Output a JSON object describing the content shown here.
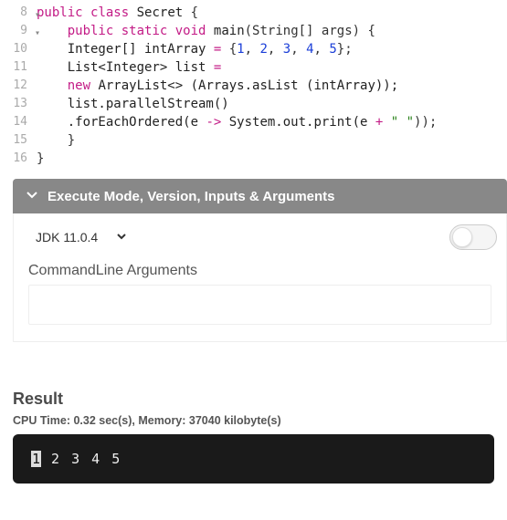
{
  "editor": {
    "lines": [
      {
        "num": "8",
        "fold": true
      },
      {
        "num": "9",
        "fold": true
      },
      {
        "num": "10"
      },
      {
        "num": "11"
      },
      {
        "num": "12"
      },
      {
        "num": "13"
      },
      {
        "num": "14"
      },
      {
        "num": "15"
      },
      {
        "num": "16"
      }
    ],
    "code": {
      "l8": {
        "kw1": "public",
        "kw2": "class",
        "name": "Secret",
        "brace": " {"
      },
      "l9": {
        "indent": "    ",
        "kw1": "public",
        "kw2": "static",
        "kw3": "void",
        "name": "main",
        "sig": "(String[] args) {"
      },
      "l10": {
        "indent": "    ",
        "a": "Integer[] intArray ",
        "eq": "=",
        "b": " {",
        "n1": "1",
        "c1": ", ",
        "n2": "2",
        "c2": ", ",
        "n3": "3",
        "c3": ", ",
        "n4": "4",
        "c4": ", ",
        "n5": "5",
        "end": "};"
      },
      "l11": {
        "indent": "    ",
        "a": "List<Integer> list ",
        "eq": "="
      },
      "l12": {
        "indent": "    ",
        "kw": "new",
        "rest": " ArrayList<> (Arrays.asList (intArray));"
      },
      "l13": {
        "indent": "    ",
        "text": "list.parallelStream()"
      },
      "l14": {
        "indent": "    ",
        "a": ".forEachOrdered(e ",
        "arrow": "->",
        "b": " System.out.print(e ",
        "plus": "+",
        "sp": " ",
        "str": "\" \"",
        "end": "));"
      },
      "l15": {
        "indent": "    ",
        "brace": "}"
      },
      "l16": {
        "brace": "}"
      }
    }
  },
  "panel": {
    "title": "Execute Mode, Version, Inputs & Arguments",
    "version": "JDK 11.0.4",
    "cmd_label": "CommandLine Arguments",
    "cmd_value": "",
    "toggle_on": false
  },
  "result": {
    "title": "Result",
    "meta": "CPU Time: 0.32 sec(s), Memory: 37040 kilobyte(s)",
    "output_first": "1",
    "output_rest": " 2 3 4 5"
  }
}
